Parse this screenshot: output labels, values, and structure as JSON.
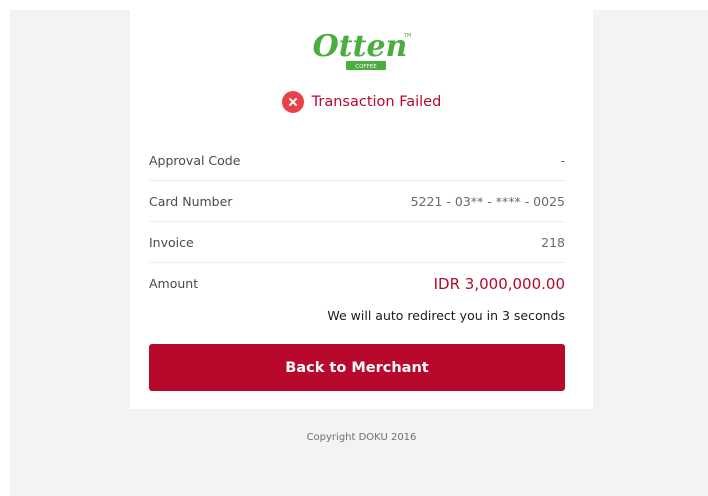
{
  "merchant": {
    "logo_text": "Otten",
    "logo_subtext": "COFFEE",
    "logo_mark": "TM",
    "brand_color": "#4bac3f"
  },
  "status": {
    "icon": "x-circle-icon",
    "text": "Transaction Failed",
    "color": "#b8082c"
  },
  "details": [
    {
      "label": "Approval Code",
      "value": "-"
    },
    {
      "label": "Card Number",
      "value": "5221 - 03** - **** - 0025"
    },
    {
      "label": "Invoice",
      "value": "218"
    },
    {
      "label": "Amount",
      "value": "IDR 3,000,000.00"
    }
  ],
  "redirect_text": "We will auto redirect you in 3 seconds",
  "back_button_label": "Back to Merchant",
  "footer": {
    "copyright": "Copyright DOKU 2016"
  }
}
